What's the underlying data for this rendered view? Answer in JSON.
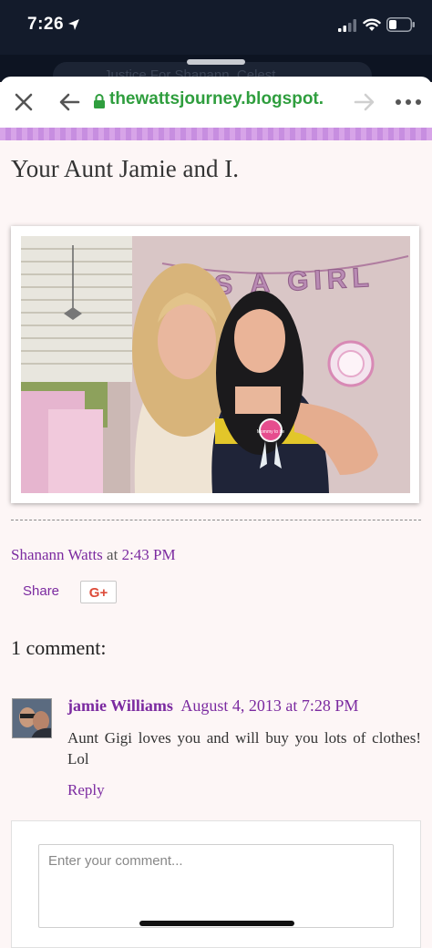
{
  "status_bar": {
    "time": "7:26"
  },
  "behind_tab": {
    "text": "Justice For Shanann, Celest"
  },
  "browser": {
    "url": "thewattsjourney.blogspot."
  },
  "post": {
    "title": "Your Aunt Jamie and I.",
    "banner_text": "IT'S A GIRL",
    "badge_text": "Mommy to be",
    "author": "Shanann Watts",
    "at_label": "at",
    "time": "2:43 PM",
    "share_label": "Share",
    "gplus_label": "G+"
  },
  "comments": {
    "heading": "1 comment:",
    "items": [
      {
        "author": "jamie Williams",
        "date": "August 4, 2013 at 7:28 PM",
        "body": "Aunt Gigi loves you and will buy you lots of clothes! Lol",
        "reply_label": "Reply"
      }
    ],
    "input_placeholder": "Enter your comment..."
  },
  "colors": {
    "link_purple": "#7b2aa0",
    "url_green": "#2f9e3e",
    "band_purple": "#d7a4e8",
    "page_bg": "#fdf6f6"
  }
}
